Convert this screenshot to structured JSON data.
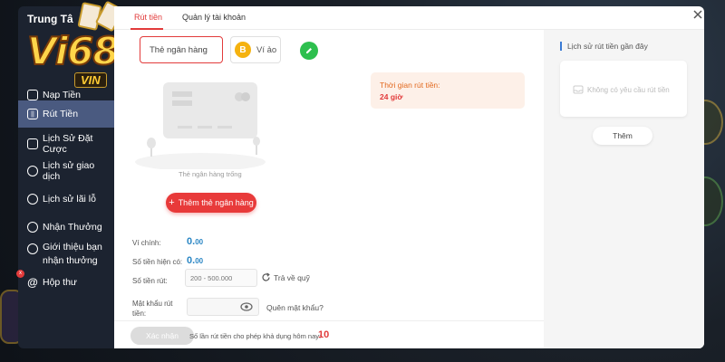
{
  "sidebar": {
    "title": "Trung Tâ",
    "items": [
      {
        "label": "Nạp Tiền",
        "icon": "deposit-icon"
      },
      {
        "label": "Rút Tiền",
        "icon": "withdraw-icon",
        "active": true
      },
      {
        "label": "Lịch Sử Đặt Cược",
        "icon": "bet-history-icon"
      },
      {
        "label": "Lịch sử giao dịch",
        "icon": "transaction-history-icon"
      },
      {
        "label": "Lịch sử lãi lỗ",
        "icon": "profit-loss-icon"
      },
      {
        "label": "Nhận Thưởng",
        "icon": "reward-icon"
      },
      {
        "label": "Giới thiệu bạn\nnhận thưởng",
        "icon": "referral-icon"
      },
      {
        "label": "Hộp thư",
        "icon": "mail-icon",
        "badge": "x"
      }
    ]
  },
  "logo": {
    "word": "Vi68",
    "sub": "VIN"
  },
  "tabs": [
    {
      "label": "Rút tiền"
    },
    {
      "label": "Quản lý tài khoản"
    }
  ],
  "methods": {
    "bank": "Thẻ ngân hàng",
    "wallet": "Ví ảo",
    "wallet_icon_letter": "B"
  },
  "bank": {
    "empty": "Thẻ ngân hàng trống",
    "add_button": "Thêm thẻ ngân hàng"
  },
  "withdraw_time": {
    "label": "Thời gian rút tiền:",
    "value": "24 giờ"
  },
  "form": {
    "wallet_label": "Ví chính:",
    "wallet_value": "0.",
    "wallet_decimals": "00",
    "current_label": "Số tiền hiện có:",
    "current_value": "0.",
    "current_decimals": "00",
    "amount_label": "Số tiền rút:",
    "amount_placeholder": "200 - 500.000",
    "refund_label": "Trả về quỹ",
    "password_label": "Mật khẩu rút\ntiền:",
    "forgot_label": "Quên mật khẩu?"
  },
  "footer": {
    "confirm": "Xác nhận",
    "limit_label": "Số lần rút tiền cho phép khả dụng hôm nay:",
    "limit_value": "10"
  },
  "history": {
    "title": "Lịch sử rút tiền gần đây",
    "empty": "Không có yêu cầu rút tiền",
    "more": "Thêm"
  },
  "colors": {
    "accent": "#e23b3b",
    "value_blue": "#2a86c4",
    "sidebar_bg": "#1c2330",
    "sidebar_active": "#4a5a80"
  }
}
